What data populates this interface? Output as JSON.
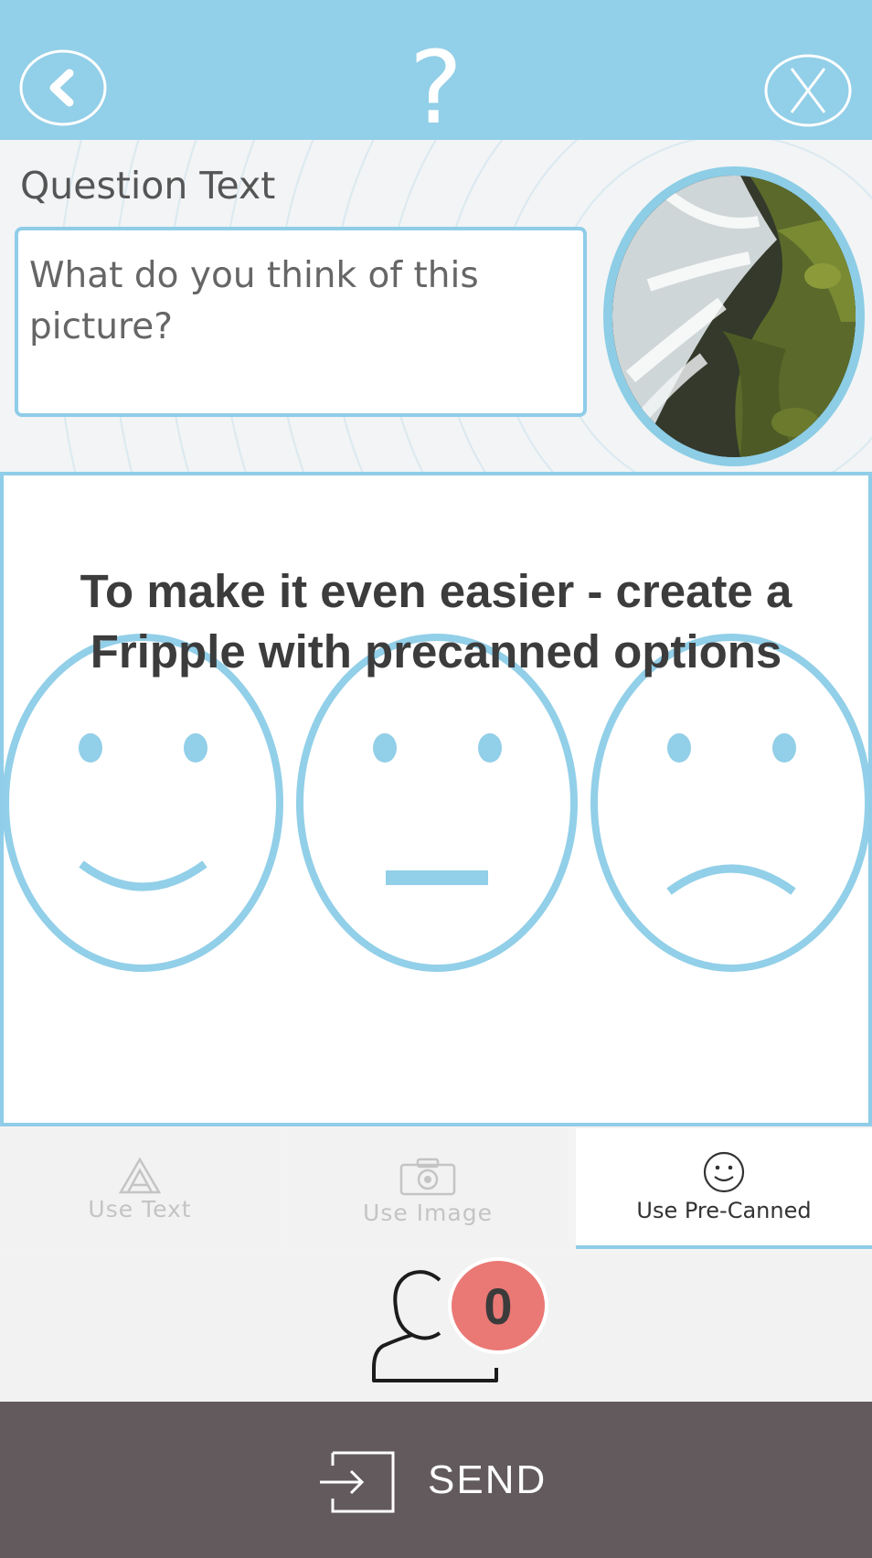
{
  "header": {
    "back_icon": "chevron-left-icon",
    "help_label": "?",
    "close_icon": "x-close-icon",
    "color": "#92cfe8"
  },
  "question": {
    "label": "Question Text",
    "value": "What do you think of this picture?",
    "image": "waterfall-photo"
  },
  "promo": {
    "line1": "To make it even easier - create a",
    "line2": "Fripple with precanned options"
  },
  "faces": [
    "happy-face-icon",
    "neutral-face-icon",
    "sad-face-icon"
  ],
  "tabs": [
    {
      "label": "Use Text",
      "icon": "text-a-icon",
      "active": false
    },
    {
      "label": "Use Image",
      "icon": "camera-icon",
      "active": false
    },
    {
      "label": "Use Pre-Canned",
      "icon": "smiley-icon",
      "active": true
    }
  ],
  "recipients": {
    "icon": "person-icon",
    "count": "0",
    "badge_color": "#ea7874"
  },
  "send": {
    "label": "SEND",
    "icon": "send-arrow-icon",
    "color": "#625a5d"
  }
}
